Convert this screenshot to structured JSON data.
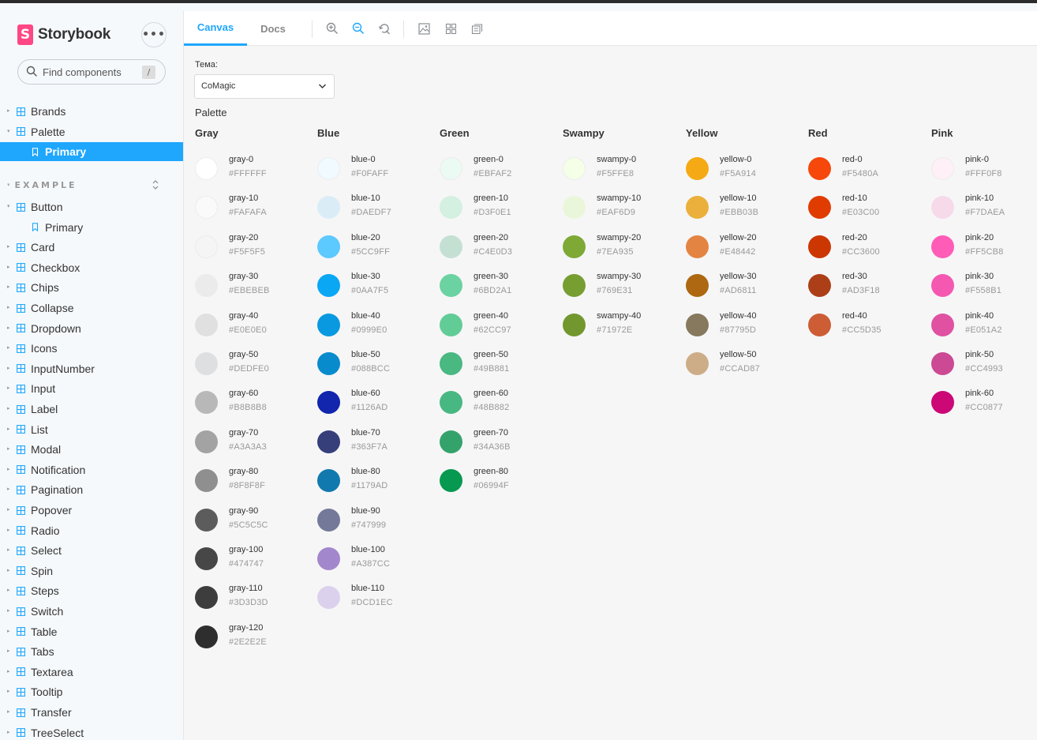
{
  "sidebar": {
    "brand": "Storybook",
    "brand_logo_letter": "S",
    "menu_glyph": "•••",
    "search_placeholder": "Find components",
    "search_shortcut": "/",
    "items_top": [
      {
        "label": "Brands",
        "kind": "component",
        "arrow": "▸"
      },
      {
        "label": "Palette",
        "kind": "component",
        "arrow": "▾"
      },
      {
        "label": "Primary",
        "kind": "story",
        "selected": true
      }
    ],
    "section_label": "EXAMPLE",
    "section_caret": "▾",
    "items_example": [
      {
        "label": "Button",
        "kind": "component",
        "arrow": "▾"
      },
      {
        "label": "Primary",
        "kind": "story"
      },
      {
        "label": "Card",
        "kind": "component",
        "arrow": "▸"
      },
      {
        "label": "Checkbox",
        "kind": "component",
        "arrow": "▸"
      },
      {
        "label": "Chips",
        "kind": "component",
        "arrow": "▸"
      },
      {
        "label": "Collapse",
        "kind": "component",
        "arrow": "▸"
      },
      {
        "label": "Dropdown",
        "kind": "component",
        "arrow": "▸"
      },
      {
        "label": "Icons",
        "kind": "component",
        "arrow": "▸"
      },
      {
        "label": "InputNumber",
        "kind": "component",
        "arrow": "▸"
      },
      {
        "label": "Input",
        "kind": "component",
        "arrow": "▸"
      },
      {
        "label": "Label",
        "kind": "component",
        "arrow": "▸"
      },
      {
        "label": "List",
        "kind": "component",
        "arrow": "▸"
      },
      {
        "label": "Modal",
        "kind": "component",
        "arrow": "▸"
      },
      {
        "label": "Notification",
        "kind": "component",
        "arrow": "▸"
      },
      {
        "label": "Pagination",
        "kind": "component",
        "arrow": "▸"
      },
      {
        "label": "Popover",
        "kind": "component",
        "arrow": "▸"
      },
      {
        "label": "Radio",
        "kind": "component",
        "arrow": "▸"
      },
      {
        "label": "Select",
        "kind": "component",
        "arrow": "▸"
      },
      {
        "label": "Spin",
        "kind": "component",
        "arrow": "▸"
      },
      {
        "label": "Steps",
        "kind": "component",
        "arrow": "▸"
      },
      {
        "label": "Switch",
        "kind": "component",
        "arrow": "▸"
      },
      {
        "label": "Table",
        "kind": "component",
        "arrow": "▸"
      },
      {
        "label": "Tabs",
        "kind": "component",
        "arrow": "▸"
      },
      {
        "label": "Textarea",
        "kind": "component",
        "arrow": "▸"
      },
      {
        "label": "Tooltip",
        "kind": "component",
        "arrow": "▸"
      },
      {
        "label": "Transfer",
        "kind": "component",
        "arrow": "▸"
      },
      {
        "label": "TreeSelect",
        "kind": "component",
        "arrow": "▸"
      }
    ]
  },
  "toolbar": {
    "tab_canvas": "Canvas",
    "tab_docs": "Docs",
    "icons": [
      "zoom-in-icon",
      "zoom-out-icon",
      "zoom-reset-icon",
      "background-icon",
      "grid-icon",
      "outline-icon"
    ]
  },
  "canvas": {
    "theme_label": "Тема:",
    "theme_value": "CoMagic",
    "palette_title": "Palette",
    "columns": [
      {
        "title": "Gray",
        "swatches": [
          {
            "name": "gray-0",
            "hex": "#FFFFFF"
          },
          {
            "name": "gray-10",
            "hex": "#FAFAFA"
          },
          {
            "name": "gray-20",
            "hex": "#F5F5F5"
          },
          {
            "name": "gray-30",
            "hex": "#EBEBEB"
          },
          {
            "name": "gray-40",
            "hex": "#E0E0E0"
          },
          {
            "name": "gray-50",
            "hex": "#DEDFE0"
          },
          {
            "name": "gray-60",
            "hex": "#B8B8B8"
          },
          {
            "name": "gray-70",
            "hex": "#A3A3A3"
          },
          {
            "name": "gray-80",
            "hex": "#8F8F8F"
          },
          {
            "name": "gray-90",
            "hex": "#5C5C5C"
          },
          {
            "name": "gray-100",
            "hex": "#474747"
          },
          {
            "name": "gray-110",
            "hex": "#3D3D3D"
          },
          {
            "name": "gray-120",
            "hex": "#2E2E2E"
          }
        ]
      },
      {
        "title": "Blue",
        "swatches": [
          {
            "name": "blue-0",
            "hex": "#F0FAFF"
          },
          {
            "name": "blue-10",
            "hex": "#DAEDF7"
          },
          {
            "name": "blue-20",
            "hex": "#5CC9FF"
          },
          {
            "name": "blue-30",
            "hex": "#0AA7F5"
          },
          {
            "name": "blue-40",
            "hex": "#0999E0"
          },
          {
            "name": "blue-50",
            "hex": "#088BCC"
          },
          {
            "name": "blue-60",
            "hex": "#1126AD"
          },
          {
            "name": "blue-70",
            "hex": "#363F7A"
          },
          {
            "name": "blue-80",
            "hex": "#1179AD"
          },
          {
            "name": "blue-90",
            "hex": "#747999"
          },
          {
            "name": "blue-100",
            "hex": "#A387CC"
          },
          {
            "name": "blue-110",
            "hex": "#DCD1EC"
          }
        ]
      },
      {
        "title": "Green",
        "swatches": [
          {
            "name": "green-0",
            "hex": "#EBFAF2"
          },
          {
            "name": "green-10",
            "hex": "#D3F0E1"
          },
          {
            "name": "green-20",
            "hex": "#C4E0D3"
          },
          {
            "name": "green-30",
            "hex": "#6BD2A1"
          },
          {
            "name": "green-40",
            "hex": "#62CC97"
          },
          {
            "name": "green-50",
            "hex": "#49B881"
          },
          {
            "name": "green-60",
            "hex": "#48B882"
          },
          {
            "name": "green-70",
            "hex": "#34A36B"
          },
          {
            "name": "green-80",
            "hex": "#06994F"
          }
        ]
      },
      {
        "title": "Swampy",
        "swatches": [
          {
            "name": "swampy-0",
            "hex": "#F5FFE8"
          },
          {
            "name": "swampy-10",
            "hex": "#EAF6D9"
          },
          {
            "name": "swampy-20",
            "hex": "#7EA935"
          },
          {
            "name": "swampy-30",
            "hex": "#769E31"
          },
          {
            "name": "swampy-40",
            "hex": "#71972E"
          }
        ]
      },
      {
        "title": "Yellow",
        "swatches": [
          {
            "name": "yellow-0",
            "hex": "#F5A914"
          },
          {
            "name": "yellow-10",
            "hex": "#EBB03B"
          },
          {
            "name": "yellow-20",
            "hex": "#E48442"
          },
          {
            "name": "yellow-30",
            "hex": "#AD6811"
          },
          {
            "name": "yellow-40",
            "hex": "#87795D"
          },
          {
            "name": "yellow-50",
            "hex": "#CCAD87"
          }
        ]
      },
      {
        "title": "Red",
        "swatches": [
          {
            "name": "red-0",
            "hex": "#F5480A"
          },
          {
            "name": "red-10",
            "hex": "#E03C00"
          },
          {
            "name": "red-20",
            "hex": "#CC3600"
          },
          {
            "name": "red-30",
            "hex": "#AD3F18"
          },
          {
            "name": "red-40",
            "hex": "#CC5D35"
          }
        ]
      },
      {
        "title": "Pink",
        "swatches": [
          {
            "name": "pink-0",
            "hex": "#FFF0F8"
          },
          {
            "name": "pink-10",
            "hex": "#F7DAEA"
          },
          {
            "name": "pink-20",
            "hex": "#FF5CB8"
          },
          {
            "name": "pink-30",
            "hex": "#F558B1"
          },
          {
            "name": "pink-40",
            "hex": "#E051A2"
          },
          {
            "name": "pink-50",
            "hex": "#CC4993"
          },
          {
            "name": "pink-60",
            "hex": "#CC0877"
          }
        ]
      }
    ]
  },
  "colors": {
    "accent": "#1ea7fd",
    "brand_pink": "#ff4785"
  }
}
